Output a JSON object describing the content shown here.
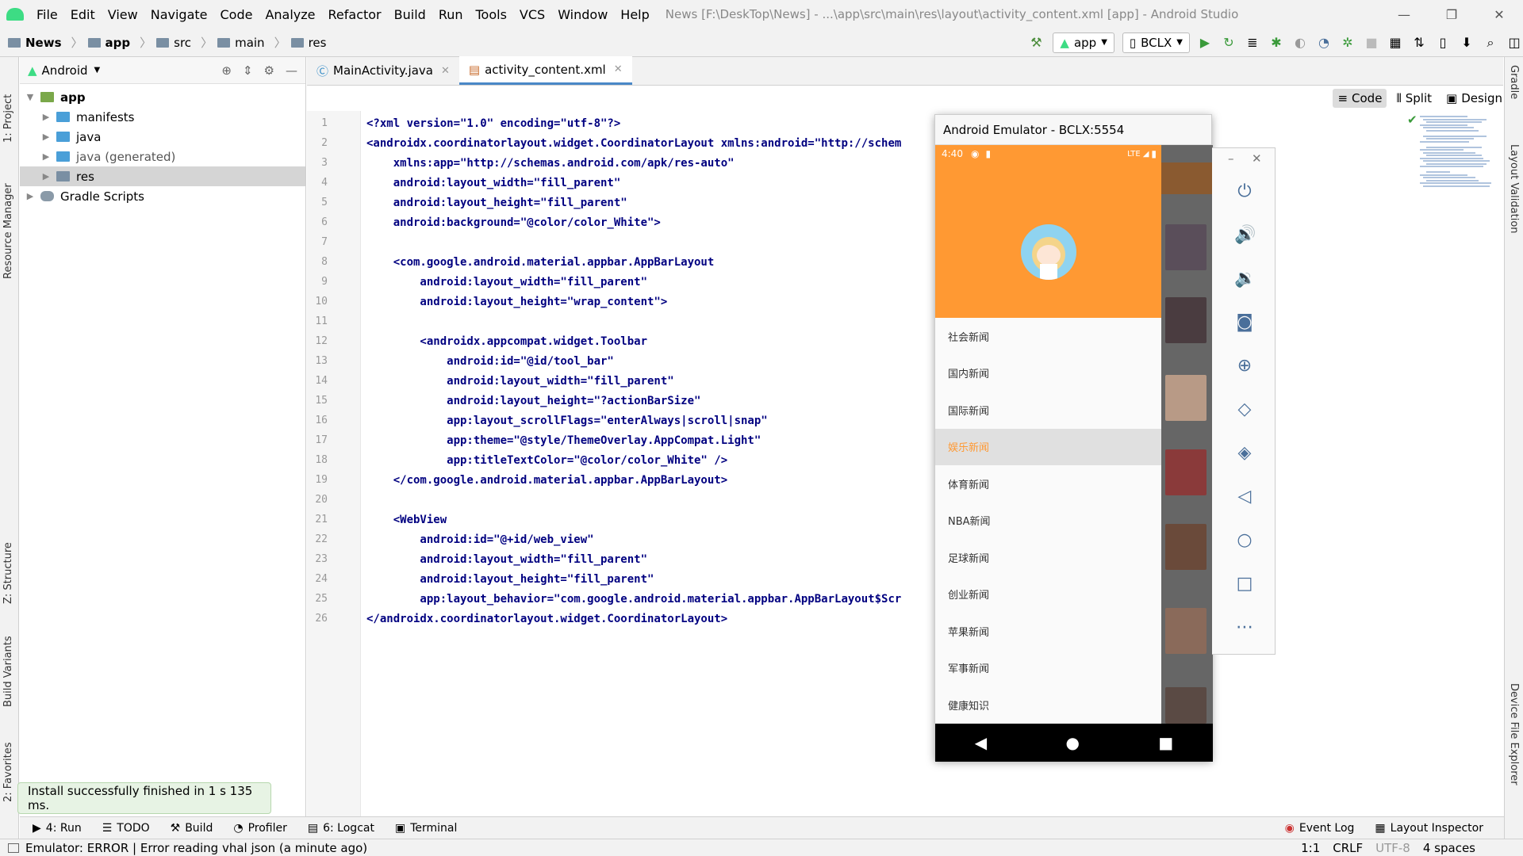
{
  "window": {
    "title": "News [F:\\DeskTop\\News] - ...\\app\\src\\main\\res\\layout\\activity_content.xml [app] - Android Studio",
    "menu": [
      "File",
      "Edit",
      "View",
      "Navigate",
      "Code",
      "Analyze",
      "Refactor",
      "Build",
      "Run",
      "Tools",
      "VCS",
      "Window",
      "Help"
    ]
  },
  "breadcrumb": [
    "News",
    "app",
    "src",
    "main",
    "res"
  ],
  "toolbar": {
    "run_config": "app",
    "device": "BCLX"
  },
  "left_tabs": {
    "project": "1: Project",
    "resource_manager": "Resource Manager",
    "structure": "Z: Structure",
    "build_variants": "Build Variants",
    "favorites": "2: Favorites"
  },
  "right_tabs": {
    "gradle": "Gradle",
    "layout_validation": "Layout Validation",
    "device_explorer": "Device File Explorer"
  },
  "project": {
    "view": "Android",
    "tree": [
      {
        "label": "app",
        "level": 0,
        "bold": true
      },
      {
        "label": "manifests",
        "level": 1
      },
      {
        "label": "java",
        "level": 1
      },
      {
        "label": "java (generated)",
        "level": 1
      },
      {
        "label": "res",
        "level": 1,
        "selected": true
      },
      {
        "label": "Gradle Scripts",
        "level": 0
      }
    ]
  },
  "editor": {
    "tabs": [
      {
        "label": "MainActivity.java",
        "active": false
      },
      {
        "label": "activity_content.xml",
        "active": true
      }
    ],
    "view_modes": [
      "Code",
      "Split",
      "Design"
    ],
    "lines": [
      "<?xml version=\"1.0\" encoding=\"utf-8\"?>",
      "<androidx.coordinatorlayout.widget.CoordinatorLayout xmlns:android=\"http://schem",
      "    xmlns:app=\"http://schemas.android.com/apk/res-auto\"",
      "    android:layout_width=\"fill_parent\"",
      "    android:layout_height=\"fill_parent\"",
      "    android:background=\"@color/color_White\">",
      "",
      "    <com.google.android.material.appbar.AppBarLayout",
      "        android:layout_width=\"fill_parent\"",
      "        android:layout_height=\"wrap_content\">",
      "",
      "        <androidx.appcompat.widget.Toolbar",
      "            android:id=\"@id/tool_bar\"",
      "            android:layout_width=\"fill_parent\"",
      "            android:layout_height=\"?actionBarSize\"",
      "            app:layout_scrollFlags=\"enterAlways|scroll|snap\"",
      "            app:theme=\"@style/ThemeOverlay.AppCompat.Light\"",
      "            app:titleTextColor=\"@color/color_White\" />",
      "    </com.google.android.material.appbar.AppBarLayout>",
      "",
      "    <WebView",
      "        android:id=\"@+id/web_view\"",
      "        android:layout_width=\"fill_parent\"",
      "        android:layout_height=\"fill_parent\"",
      "        app:layout_behavior=\"com.google.android.material.appbar.AppBarLayout$Scr",
      "</androidx.coordinatorlayout.widget.CoordinatorLayout>"
    ]
  },
  "emulator": {
    "title": "Android Emulator - BCLX:5554",
    "time": "4:40",
    "network": "LTE",
    "drawer_items": [
      "社会新闻",
      "国内新闻",
      "国际新闻",
      "娱乐新闻",
      "体育新闻",
      "NBA新闻",
      "足球新闻",
      "创业新闻",
      "苹果新闻",
      "军事新闻",
      "健康知识"
    ],
    "selected_item": "娱乐新闻",
    "accent": "#ff9933"
  },
  "toast": "Install successfully finished in 1 s 135 ms.",
  "bottom_tools": [
    "4: Run",
    "TODO",
    "Build",
    "Profiler",
    "6: Logcat",
    "Terminal",
    "Event Log",
    "Layout Inspector"
  ],
  "status": {
    "message": "Emulator: ERROR  | Error reading vhal json (a minute ago)",
    "position": "1:1",
    "line_sep": "CRLF",
    "encoding": "UTF-8",
    "indent": "4 spaces"
  }
}
